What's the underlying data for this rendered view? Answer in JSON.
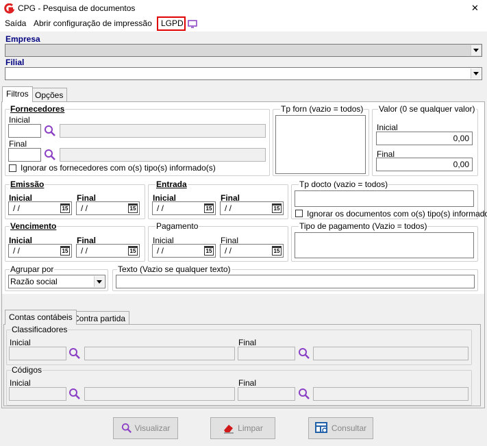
{
  "window": {
    "title": "CPG - Pesquisa de documentos",
    "close": "✕"
  },
  "menu": {
    "saida": "Saída",
    "config": "Abrir configuração de impressão",
    "lgpd": "LGPD"
  },
  "empresa": {
    "label": "Empresa",
    "value": ""
  },
  "filial": {
    "label": "Filial",
    "value": ""
  },
  "tabs": {
    "filtros": "Filtros",
    "opcoes": "Opções"
  },
  "fornecedores": {
    "title": "Fornecedores",
    "inicial": "Inicial",
    "final": "Final",
    "ignorar": "Ignorar os fornecedores com o(s) tipo(s) informado(s)"
  },
  "tpforn": {
    "title": "Tp forn (vazio = todos)"
  },
  "valor": {
    "title": "Valor (0 se qualquer valor)",
    "inicial": "Inicial",
    "inicial_value": "0,00",
    "final": "Final",
    "final_value": "0,00"
  },
  "emissao": {
    "title": "Emissão",
    "inicial": "Inicial",
    "final": "Final",
    "inicial_value": "/ /",
    "final_value": "/ /"
  },
  "entrada": {
    "title": "Entrada",
    "inicial": "Inicial",
    "final": "Final",
    "inicial_value": "/ /",
    "final_value": "/ /"
  },
  "tpdocto": {
    "title": "Tp docto (vazio = todos)",
    "ignorar": "Ignorar os documentos com o(s) tipo(s) informado(s)"
  },
  "vencimento": {
    "title": "Vencimento",
    "inicial": "Inicial",
    "final": "Final",
    "inicial_value": "/ /",
    "final_value": "/ /"
  },
  "pagamento": {
    "title": "Pagamento",
    "inicial": "Inicial",
    "final": "Final",
    "inicial_value": "/ /",
    "final_value": "/ /"
  },
  "tipopag": {
    "title": "Tipo de pagamento (Vazio = todos)"
  },
  "agrupar": {
    "title": "Agrupar por",
    "value": "Razão social"
  },
  "texto": {
    "title": "Texto (Vazio se qualquer texto)"
  },
  "subtabs": {
    "contas": "Contas contábeis",
    "contra": "Contra partida"
  },
  "classificadores": {
    "title": "Classificadores",
    "inicial": "Inicial",
    "final": "Final"
  },
  "codigos": {
    "title": "Códigos",
    "inicial": "Inicial",
    "final": "Final"
  },
  "buttons": {
    "visualizar": "Visualizar",
    "limpar": "Limpar",
    "consultar": "Consultar"
  },
  "calendar_glyph": "15",
  "colors": {
    "accent_red": "#e02020",
    "lgpd_border": "#e00000",
    "magnifier": "#8a3fc4",
    "navy": "#000080"
  }
}
